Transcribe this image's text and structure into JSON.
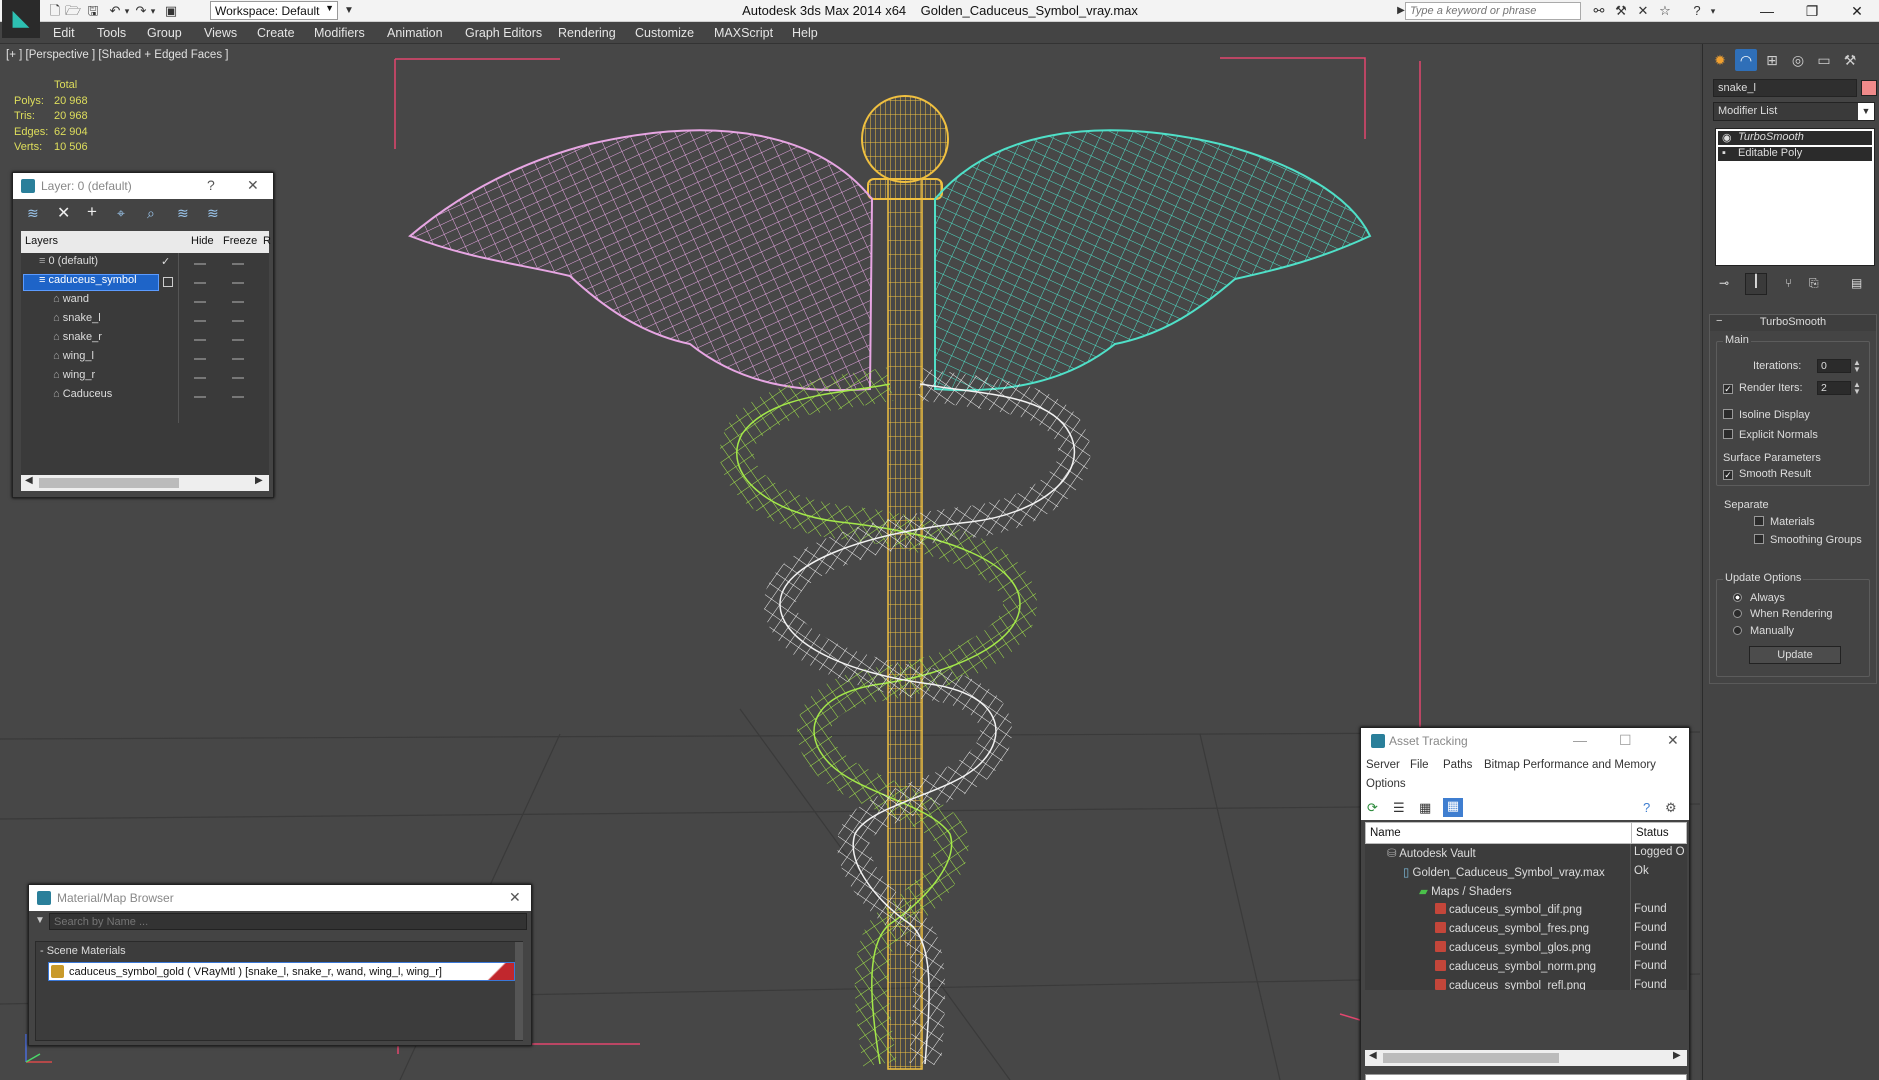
{
  "titlebar": {
    "app_title": "Autodesk 3ds Max  2014 x64",
    "file_title": "Golden_Caduceus_Symbol_vray.max",
    "workspace": "Workspace: Default",
    "search_placeholder": "Type a keyword or phrase"
  },
  "menu": [
    "Edit",
    "Tools",
    "Group",
    "Views",
    "Create",
    "Modifiers",
    "Animation",
    "Graph Editors",
    "Rendering",
    "Customize",
    "MAXScript",
    "Help"
  ],
  "viewport": {
    "label": "[+ ] [Perspective ] [Shaded + Edged Faces ]",
    "stats": {
      "header": "Total",
      "polys_label": "Polys:",
      "polys": "20 968",
      "tris_label": "Tris:",
      "tris": "20 968",
      "edges_label": "Edges:",
      "edges": "62 904",
      "verts_label": "Verts:",
      "verts": "10 506"
    }
  },
  "layer_panel": {
    "title": "Layer: 0 (default)",
    "help": "?",
    "col_layers": "Layers",
    "col_hide": "Hide",
    "col_freeze": "Freeze",
    "col_extra": "R",
    "items": [
      {
        "label": "0 (default)",
        "level": 0
      },
      {
        "label": "caduceus_symbol",
        "level": 0,
        "selected": true
      },
      {
        "label": "wand",
        "level": 1
      },
      {
        "label": "snake_l",
        "level": 1
      },
      {
        "label": "snake_r",
        "level": 1
      },
      {
        "label": "wing_l",
        "level": 1
      },
      {
        "label": "wing_r",
        "level": 1
      },
      {
        "label": "Caduceus",
        "level": 1
      }
    ]
  },
  "material_browser": {
    "title": "Material/Map Browser",
    "search_placeholder": "Search by Name ...",
    "section": "- Scene Materials",
    "material": "caduceus_symbol_gold  ( VRayMtl ) [snake_l, snake_r, wand, wing_l, wing_r]",
    "accent_color": "#c1272d"
  },
  "asset_tracking": {
    "title": "Asset Tracking",
    "menu": [
      "Server",
      "File",
      "Paths",
      "Bitmap Performance and Memory",
      "Options"
    ],
    "col_name": "Name",
    "col_status": "Status",
    "rows": [
      {
        "name": "Autodesk Vault",
        "status": "Logged O",
        "level": 0,
        "icon": "vault-icon"
      },
      {
        "name": "Golden_Caduceus_Symbol_vray.max",
        "status": "Ok",
        "level": 1,
        "icon": "max-file-icon"
      },
      {
        "name": "Maps / Shaders",
        "status": "",
        "level": 2,
        "icon": "maps-folder-icon"
      },
      {
        "name": "caduceus_symbol_dif.png",
        "status": "Found",
        "level": 3,
        "icon": "png-file-icon"
      },
      {
        "name": "caduceus_symbol_fres.png",
        "status": "Found",
        "level": 3,
        "icon": "png-file-icon"
      },
      {
        "name": "caduceus_symbol_glos.png",
        "status": "Found",
        "level": 3,
        "icon": "png-file-icon"
      },
      {
        "name": "caduceus_symbol_norm.png",
        "status": "Found",
        "level": 3,
        "icon": "png-file-icon"
      },
      {
        "name": "caduceus_symbol_refl.png",
        "status": "Found",
        "level": 3,
        "icon": "png-file-icon"
      }
    ]
  },
  "command_panel": {
    "object_name": "snake_l",
    "object_color": "#f08a8a",
    "modifier_list": "Modifier List",
    "stack": [
      "TurboSmooth",
      "Editable Poly"
    ],
    "rollout_title": "TurboSmooth",
    "main_group": "Main",
    "iterations_label": "Iterations:",
    "iterations": "0",
    "render_iters_label": "Render Iters:",
    "render_iters": "2",
    "render_iters_checked": true,
    "isoline_label": "Isoline Display",
    "explicit_normals_label": "Explicit Normals",
    "surface_params": "Surface Parameters",
    "smooth_result": "Smooth Result",
    "separate": "Separate",
    "materials": "Materials",
    "smoothing_groups": "Smoothing Groups",
    "update_options": "Update Options",
    "always": "Always",
    "when_rendering": "When Rendering",
    "manually": "Manually",
    "update_button": "Update"
  },
  "wire_colors": {
    "wing_l": "#e7a6e3",
    "wing_r": "#4fe0c8",
    "wand": "#f0c040",
    "snake_l": "#a4e84a",
    "snake_r": "#ffffff",
    "bbox": "#e2476f"
  }
}
